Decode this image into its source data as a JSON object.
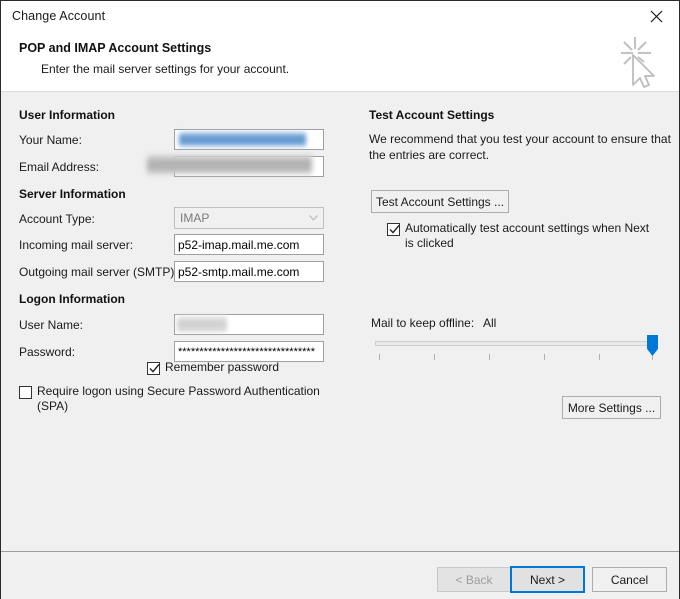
{
  "window": {
    "title": "Change Account",
    "close_icon": "close-icon"
  },
  "header": {
    "title": "POP and IMAP Account Settings",
    "subtitle": "Enter the mail server settings for your account.",
    "icon": "cursor-click-icon"
  },
  "left_panel": {
    "user_information": {
      "group_label": "User Information",
      "fields": [
        {
          "label": "Your Name:",
          "accel": "Y",
          "value": "",
          "redacted": true
        },
        {
          "label": "Email Address:",
          "accel": "E",
          "value": "",
          "redacted": true
        }
      ]
    },
    "server_information": {
      "group_label": "Server Information",
      "account_type": {
        "label": "Account Type:",
        "accel": "A",
        "value": "IMAP",
        "disabled": true
      },
      "incoming": {
        "label": "Incoming mail server:",
        "accel": "I",
        "value": "p52-imap.mail.me.com"
      },
      "outgoing": {
        "label": "Outgoing mail server (SMTP):",
        "accel": "O",
        "value": "p52-smtp.mail.me.com"
      }
    },
    "logon_information": {
      "group_label": "Logon Information",
      "user_name": {
        "label": "User Name:",
        "accel": "U",
        "value": "",
        "redacted": true
      },
      "password": {
        "label": "Password:",
        "accel": "P",
        "value": "********************************"
      },
      "remember_password": {
        "label": "Remember password",
        "accel": "R",
        "checked": true
      },
      "require_spa": {
        "label": "Require logon using Secure Password Authentication",
        "label_line2": "(SPA)",
        "accel": "R",
        "checked": false
      }
    }
  },
  "right_panel": {
    "test_account_settings": {
      "group_label": "Test Account Settings",
      "description_line1": "We recommend that you test your account to ensure that",
      "description_line2": "the entries are correct.",
      "button_label": "Test Account Settings ...",
      "auto_test": {
        "label_line1": "Automatically test account settings when Next",
        "label_line2": "is clicked",
        "checked": true
      }
    },
    "mail_to_keep_offline": {
      "label": "Mail to keep offline:",
      "value": "All",
      "tick_count": 6,
      "thumb_position_percent": 100,
      "accent_color": "#0078d7"
    },
    "more_settings_button": "More Settings ..."
  },
  "footer": {
    "back_button": {
      "label": "< Back",
      "accel": "B",
      "disabled": true
    },
    "next_button": {
      "label": "Next >",
      "accel": "N",
      "focused": true
    },
    "cancel_button": {
      "label": "Cancel",
      "accel": ""
    }
  }
}
